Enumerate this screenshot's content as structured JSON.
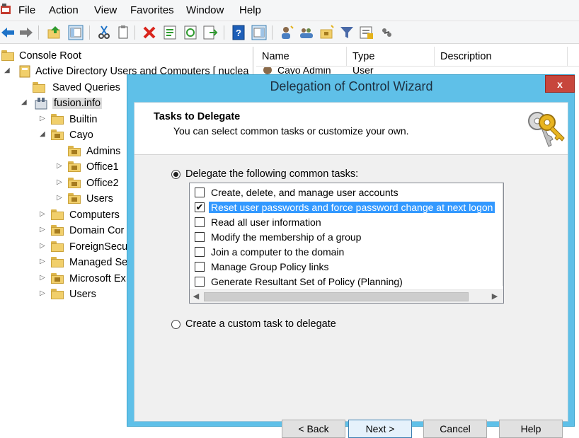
{
  "menu": [
    "File",
    "Action",
    "View",
    "Favorites",
    "Window",
    "Help"
  ],
  "toolbar_icons": [
    "back-icon",
    "forward-icon",
    "up-folder-icon",
    "show-tree-icon",
    "cut-icon",
    "copy-icon",
    "delete-icon",
    "properties-icon",
    "refresh-icon",
    "export-icon",
    "help-icon",
    "action-pane-icon",
    "add-user-icon",
    "add-group-icon",
    "add-ou-icon",
    "filter-icon",
    "find-icon",
    "delegate-icon"
  ],
  "tree": {
    "console_root": "Console Root",
    "aduc": "Active Directory Users and Computers [ nuclea",
    "saved_queries": "Saved Queries",
    "domain": "fusion.info",
    "builtin": "Builtin",
    "cayo": "Cayo",
    "admins": "Admins",
    "office1": "Office1",
    "office2": "Office2",
    "users_ou": "Users",
    "computers": "Computers",
    "domain_controllers": "Domain Cor",
    "foreign_security": "ForeignSecu",
    "managed_service": "Managed Se",
    "microsoft_exchange": "Microsoft Ex",
    "users": "Users"
  },
  "list": {
    "columns": [
      "Name",
      "Type",
      "Description"
    ],
    "row_name": "Cayo Admin",
    "row_type": "User"
  },
  "dialog": {
    "title": "Delegation of Control Wizard",
    "close": "x",
    "header_title": "Tasks to Delegate",
    "header_subtitle": "You can select common tasks or customize your own.",
    "option_common": "Delegate the following common tasks:",
    "option_custom": "Create a custom task to delegate",
    "selected_option": "common",
    "tasks": [
      {
        "label": "Create, delete, and manage user accounts",
        "checked": false,
        "selected": false
      },
      {
        "label": "Reset user passwords and force password change at next logon",
        "checked": true,
        "selected": true
      },
      {
        "label": "Read all user information",
        "checked": false,
        "selected": false
      },
      {
        "label": "Modify the membership of a group",
        "checked": false,
        "selected": false
      },
      {
        "label": "Join a computer to the domain",
        "checked": false,
        "selected": false
      },
      {
        "label": "Manage Group Policy links",
        "checked": false,
        "selected": false
      },
      {
        "label": "Generate Resultant Set of Policy (Planning)",
        "checked": false,
        "selected": false
      }
    ],
    "buttons": {
      "back": "< Back",
      "next": "Next >",
      "cancel": "Cancel",
      "help": "Help"
    }
  }
}
